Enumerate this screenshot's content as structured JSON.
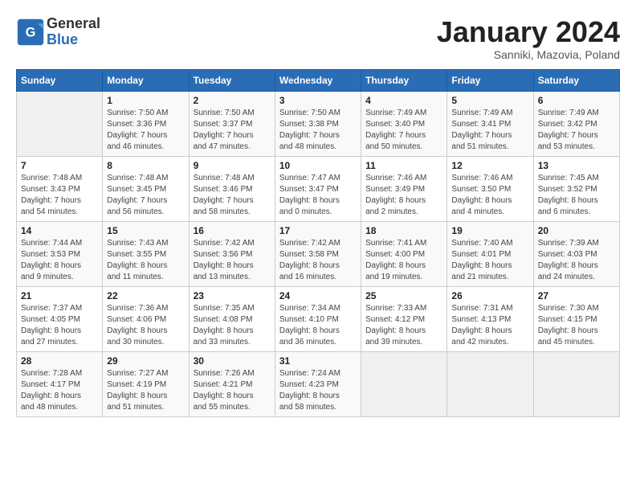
{
  "header": {
    "logo_general": "General",
    "logo_blue": "Blue",
    "month_title": "January 2024",
    "location": "Sanniki, Mazovia, Poland"
  },
  "days_of_week": [
    "Sunday",
    "Monday",
    "Tuesday",
    "Wednesday",
    "Thursday",
    "Friday",
    "Saturday"
  ],
  "weeks": [
    [
      {
        "day": "",
        "content": ""
      },
      {
        "day": "1",
        "content": "Sunrise: 7:50 AM\nSunset: 3:36 PM\nDaylight: 7 hours\nand 46 minutes."
      },
      {
        "day": "2",
        "content": "Sunrise: 7:50 AM\nSunset: 3:37 PM\nDaylight: 7 hours\nand 47 minutes."
      },
      {
        "day": "3",
        "content": "Sunrise: 7:50 AM\nSunset: 3:38 PM\nDaylight: 7 hours\nand 48 minutes."
      },
      {
        "day": "4",
        "content": "Sunrise: 7:49 AM\nSunset: 3:40 PM\nDaylight: 7 hours\nand 50 minutes."
      },
      {
        "day": "5",
        "content": "Sunrise: 7:49 AM\nSunset: 3:41 PM\nDaylight: 7 hours\nand 51 minutes."
      },
      {
        "day": "6",
        "content": "Sunrise: 7:49 AM\nSunset: 3:42 PM\nDaylight: 7 hours\nand 53 minutes."
      }
    ],
    [
      {
        "day": "7",
        "content": "Sunrise: 7:48 AM\nSunset: 3:43 PM\nDaylight: 7 hours\nand 54 minutes."
      },
      {
        "day": "8",
        "content": "Sunrise: 7:48 AM\nSunset: 3:45 PM\nDaylight: 7 hours\nand 56 minutes."
      },
      {
        "day": "9",
        "content": "Sunrise: 7:48 AM\nSunset: 3:46 PM\nDaylight: 7 hours\nand 58 minutes."
      },
      {
        "day": "10",
        "content": "Sunrise: 7:47 AM\nSunset: 3:47 PM\nDaylight: 8 hours\nand 0 minutes."
      },
      {
        "day": "11",
        "content": "Sunrise: 7:46 AM\nSunset: 3:49 PM\nDaylight: 8 hours\nand 2 minutes."
      },
      {
        "day": "12",
        "content": "Sunrise: 7:46 AM\nSunset: 3:50 PM\nDaylight: 8 hours\nand 4 minutes."
      },
      {
        "day": "13",
        "content": "Sunrise: 7:45 AM\nSunset: 3:52 PM\nDaylight: 8 hours\nand 6 minutes."
      }
    ],
    [
      {
        "day": "14",
        "content": "Sunrise: 7:44 AM\nSunset: 3:53 PM\nDaylight: 8 hours\nand 9 minutes."
      },
      {
        "day": "15",
        "content": "Sunrise: 7:43 AM\nSunset: 3:55 PM\nDaylight: 8 hours\nand 11 minutes."
      },
      {
        "day": "16",
        "content": "Sunrise: 7:42 AM\nSunset: 3:56 PM\nDaylight: 8 hours\nand 13 minutes."
      },
      {
        "day": "17",
        "content": "Sunrise: 7:42 AM\nSunset: 3:58 PM\nDaylight: 8 hours\nand 16 minutes."
      },
      {
        "day": "18",
        "content": "Sunrise: 7:41 AM\nSunset: 4:00 PM\nDaylight: 8 hours\nand 19 minutes."
      },
      {
        "day": "19",
        "content": "Sunrise: 7:40 AM\nSunset: 4:01 PM\nDaylight: 8 hours\nand 21 minutes."
      },
      {
        "day": "20",
        "content": "Sunrise: 7:39 AM\nSunset: 4:03 PM\nDaylight: 8 hours\nand 24 minutes."
      }
    ],
    [
      {
        "day": "21",
        "content": "Sunrise: 7:37 AM\nSunset: 4:05 PM\nDaylight: 8 hours\nand 27 minutes."
      },
      {
        "day": "22",
        "content": "Sunrise: 7:36 AM\nSunset: 4:06 PM\nDaylight: 8 hours\nand 30 minutes."
      },
      {
        "day": "23",
        "content": "Sunrise: 7:35 AM\nSunset: 4:08 PM\nDaylight: 8 hours\nand 33 minutes."
      },
      {
        "day": "24",
        "content": "Sunrise: 7:34 AM\nSunset: 4:10 PM\nDaylight: 8 hours\nand 36 minutes."
      },
      {
        "day": "25",
        "content": "Sunrise: 7:33 AM\nSunset: 4:12 PM\nDaylight: 8 hours\nand 39 minutes."
      },
      {
        "day": "26",
        "content": "Sunrise: 7:31 AM\nSunset: 4:13 PM\nDaylight: 8 hours\nand 42 minutes."
      },
      {
        "day": "27",
        "content": "Sunrise: 7:30 AM\nSunset: 4:15 PM\nDaylight: 8 hours\nand 45 minutes."
      }
    ],
    [
      {
        "day": "28",
        "content": "Sunrise: 7:28 AM\nSunset: 4:17 PM\nDaylight: 8 hours\nand 48 minutes."
      },
      {
        "day": "29",
        "content": "Sunrise: 7:27 AM\nSunset: 4:19 PM\nDaylight: 8 hours\nand 51 minutes."
      },
      {
        "day": "30",
        "content": "Sunrise: 7:26 AM\nSunset: 4:21 PM\nDaylight: 8 hours\nand 55 minutes."
      },
      {
        "day": "31",
        "content": "Sunrise: 7:24 AM\nSunset: 4:23 PM\nDaylight: 8 hours\nand 58 minutes."
      },
      {
        "day": "",
        "content": ""
      },
      {
        "day": "",
        "content": ""
      },
      {
        "day": "",
        "content": ""
      }
    ]
  ]
}
